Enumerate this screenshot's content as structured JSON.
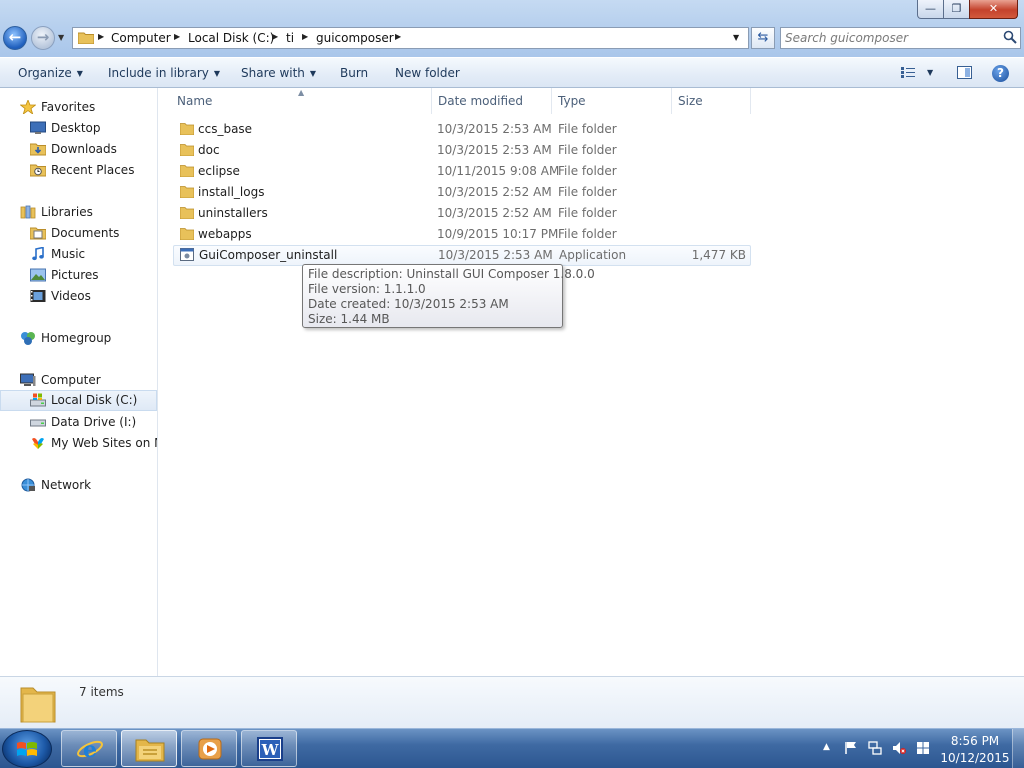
{
  "window": {
    "minimize_glyph": "—",
    "maximize_glyph": "❐",
    "close_glyph": "✕"
  },
  "address": {
    "breadcrumbs": [
      "Computer",
      "Local Disk (C:)",
      "ti",
      "guicomposer"
    ],
    "separator_glyph": "▶",
    "dropdown_glyph": "▼"
  },
  "nav_buttons": {
    "back_glyph": "←",
    "forward_glyph": "→",
    "refresh_glyph": "⇆"
  },
  "search": {
    "placeholder": "Search guicomposer",
    "icon": "search-icon"
  },
  "commandbar": {
    "organize": "Organize",
    "include_in_library": "Include in library",
    "share_with": "Share with",
    "burn": "Burn",
    "new_folder": "New folder",
    "caret": "▼",
    "help_glyph": "?"
  },
  "navigation": {
    "favorites": "Favorites",
    "desktop": "Desktop",
    "downloads": "Downloads",
    "recent_places": "Recent Places",
    "libraries": "Libraries",
    "documents": "Documents",
    "music": "Music",
    "pictures": "Pictures",
    "videos": "Videos",
    "homegroup": "Homegroup",
    "computer": "Computer",
    "local_disk": "Local Disk (C:)",
    "data_drive": "Data Drive (I:)",
    "my_web_sites": "My Web Sites on MSN",
    "network": "Network"
  },
  "columns": {
    "name": "Name",
    "date_modified": "Date modified",
    "type": "Type",
    "size": "Size",
    "sort_glyph": "▲"
  },
  "files": [
    {
      "name": "ccs_base",
      "date": "10/3/2015 2:53 AM",
      "type": "File folder",
      "size": ""
    },
    {
      "name": "doc",
      "date": "10/3/2015 2:53 AM",
      "type": "File folder",
      "size": ""
    },
    {
      "name": "eclipse",
      "date": "10/11/2015 9:08 AM",
      "type": "File folder",
      "size": ""
    },
    {
      "name": "install_logs",
      "date": "10/3/2015 2:52 AM",
      "type": "File folder",
      "size": ""
    },
    {
      "name": "uninstallers",
      "date": "10/3/2015 2:52 AM",
      "type": "File folder",
      "size": ""
    },
    {
      "name": "webapps",
      "date": "10/9/2015 10:17 PM",
      "type": "File folder",
      "size": ""
    },
    {
      "name": "GuiComposer_uninstall",
      "date": "10/3/2015 2:53 AM",
      "type": "Application",
      "size": "1,477 KB"
    }
  ],
  "tooltip": {
    "description": "File description: Uninstall GUI Composer 1.8.0.0",
    "version": "File version: 1.1.1.0",
    "created": "Date created: 10/3/2015 2:53 AM",
    "size": "Size: 1.44 MB"
  },
  "status": {
    "item_count": "7 items"
  },
  "taskbar": {
    "time": "8:56 PM",
    "date": "10/12/2015",
    "tray_up_glyph": "▲",
    "apps": [
      "internet-explorer",
      "windows-explorer",
      "media-player",
      "microsoft-word"
    ]
  },
  "colors": {
    "folder": "#e8c15a",
    "accent": "#1e395b",
    "selection": "#dfe9f6",
    "taskbar": "#3f6aa3"
  }
}
